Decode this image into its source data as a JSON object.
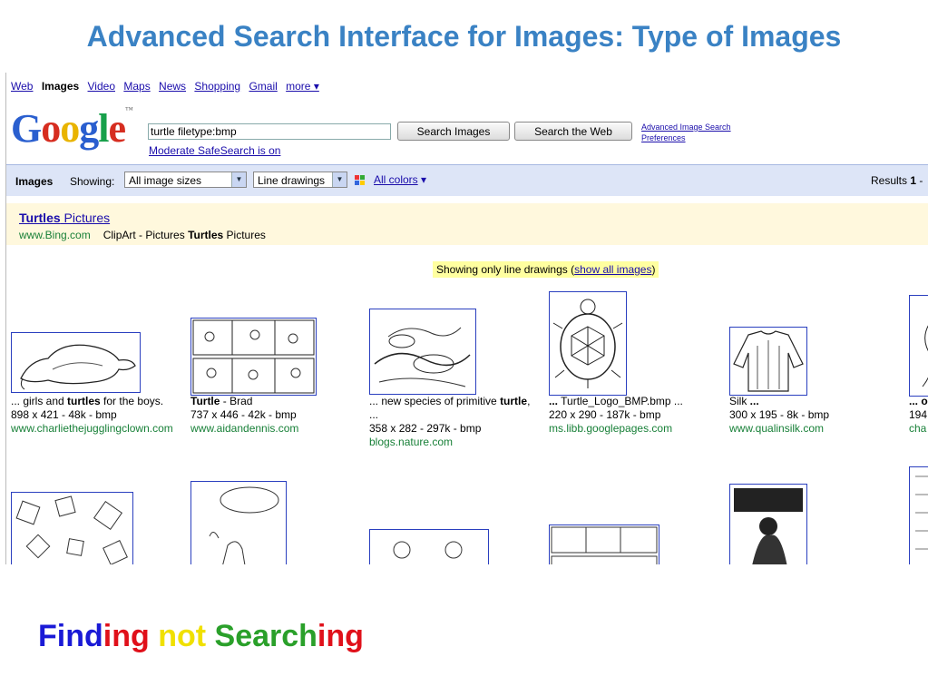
{
  "slide": {
    "title": "Advanced Search Interface for Images: Type of Images",
    "tagline_parts": [
      {
        "text": "Find",
        "color": "#1a1ad6"
      },
      {
        "text": "ing",
        "color": "#e0101a"
      },
      {
        "text": " ",
        "color": "#000000"
      },
      {
        "text": "not",
        "color": "#f0e000"
      },
      {
        "text": " ",
        "color": "#000000"
      },
      {
        "text": "Search",
        "color": "#2aa02a"
      },
      {
        "text": "ing",
        "color": "#e0101a"
      }
    ]
  },
  "nav": {
    "items": [
      {
        "label": "Web",
        "current": false
      },
      {
        "label": "Images",
        "current": true
      },
      {
        "label": "Video",
        "current": false
      },
      {
        "label": "Maps",
        "current": false
      },
      {
        "label": "News",
        "current": false
      },
      {
        "label": "Shopping",
        "current": false
      },
      {
        "label": "Gmail",
        "current": false
      },
      {
        "label": "more ▾",
        "current": false
      }
    ]
  },
  "logo": {
    "letters": [
      "G",
      "o",
      "o",
      "g",
      "l",
      "e"
    ],
    "tm": "™"
  },
  "search": {
    "query": "turtle filetype:bmp",
    "search_images_label": "Search Images",
    "search_web_label": "Search the Web",
    "safesearch": "Moderate SafeSearch is on",
    "advanced_link": "Advanced Image Search",
    "preferences_link": "Preferences"
  },
  "filters": {
    "section_label": "Images",
    "showing_label": "Showing:",
    "size_value": "All image sizes",
    "type_value": "Line drawings",
    "colors_label": "All colors",
    "colors_arrow": "▾",
    "results_prefix": "Results ",
    "results_bold": "1",
    "results_suffix": " -"
  },
  "ad": {
    "title_bold": "Turtles",
    "title_rest": " Pictures",
    "url": "www.Bing.com",
    "desc_pre": "ClipArt - Pictures ",
    "desc_bold": "Turtles",
    "desc_post": " Pictures"
  },
  "notice": {
    "prefix": "Showing only line drawings (",
    "link": "show all images",
    "suffix": ")"
  },
  "results_row1": [
    {
      "pre": "... girls and ",
      "bold": "turtles",
      "post": " for the boys.",
      "meta": "898 x 421 - 48k - bmp",
      "meta2": "",
      "site": "www.charliethejugglingclown.com"
    },
    {
      "pre": "",
      "bold": "Turtle",
      "post": " - Brad",
      "meta": "737 x 446 - 42k - bmp",
      "meta2": "",
      "site": "www.aidandennis.com"
    },
    {
      "pre": "... new species of primitive ",
      "bold": "turtle",
      "post": ",",
      "meta": "...",
      "meta2": "358 x 282 - 297k - bmp",
      "site": "blogs.nature.com"
    },
    {
      "pre": "",
      "bold": "...",
      "post": " Turtle_Logo_BMP.bmp ...",
      "meta": "220 x 290 - 187k - bmp",
      "meta2": "",
      "site": "ms.libb.googlepages.com"
    },
    {
      "pre": "Silk ",
      "bold": "...",
      "post": "",
      "meta": "300 x 195 - 8k - bmp",
      "meta2": "",
      "site": "www.qualinsilk.com"
    },
    {
      "pre": "",
      "bold": "... o",
      "post": "",
      "meta": "194",
      "meta2": "",
      "site": "cha"
    }
  ],
  "colors": {
    "link": "#1a0dab",
    "url_green": "#188038",
    "title_blue": "#3a82c4",
    "thumb_border": "#2a3fbf"
  }
}
